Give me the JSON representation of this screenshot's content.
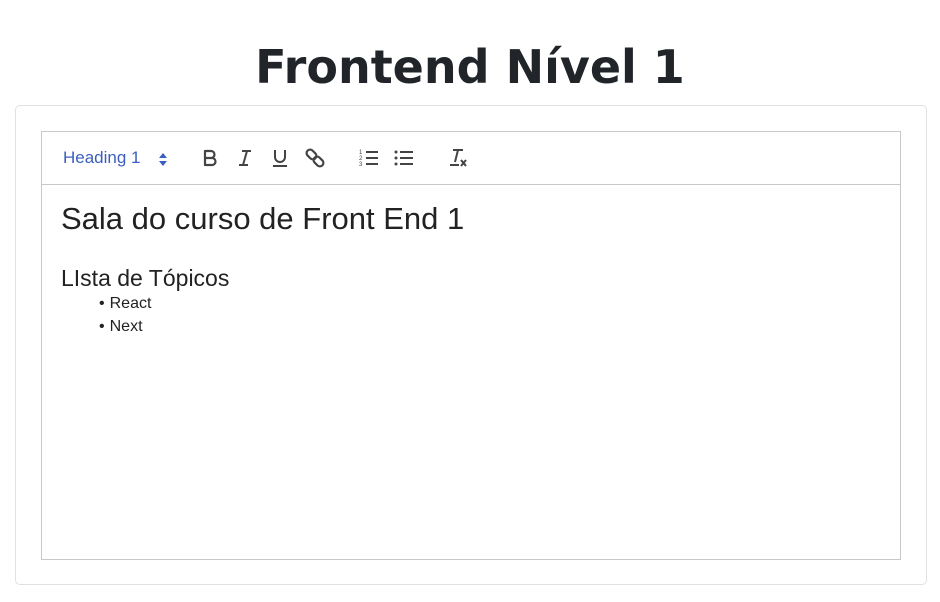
{
  "page": {
    "title": "Frontend Nível 1"
  },
  "toolbar": {
    "header_select": {
      "value": "Heading 1"
    },
    "buttons": [
      {
        "name": "bold",
        "icon": "bold-icon"
      },
      {
        "name": "italic",
        "icon": "italic-icon"
      },
      {
        "name": "underline",
        "icon": "underline-icon"
      },
      {
        "name": "link",
        "icon": "link-icon"
      },
      {
        "name": "ordered-list",
        "icon": "ordered-list-icon"
      },
      {
        "name": "bullet-list",
        "icon": "bullet-list-icon"
      },
      {
        "name": "clear-format",
        "icon": "clear-format-icon"
      }
    ],
    "accent_color": "#3b5fbf",
    "icon_color": "#444444"
  },
  "editor": {
    "heading1": "Sala do curso de Front End 1",
    "heading3": "LIsta de Tópicos",
    "list_items": [
      "React",
      "Next"
    ]
  }
}
